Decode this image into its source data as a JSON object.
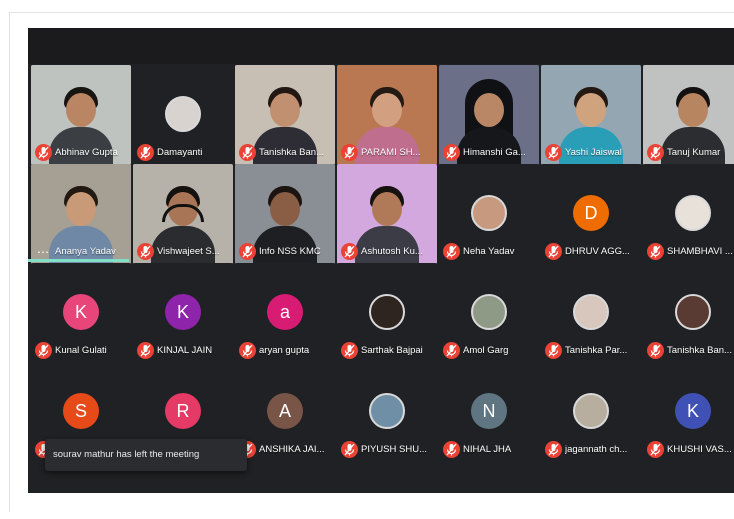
{
  "meeting": {
    "toast_message": "sourav mathur has left the meeting",
    "more_options_glyph": "⋯",
    "colors": {
      "muted_mic": "#ea4335",
      "tile_background": "#3c4043",
      "meeting_background": "#202124",
      "active_speaker": "#8ab4f8"
    }
  },
  "participants": [
    {
      "name": "Abhinav Gupta",
      "kind": "video",
      "bg": "#bfc3bf",
      "skin": "#b98562",
      "hair": "#171412",
      "shirt": "#3b3f44"
    },
    {
      "name": "Damayanti",
      "kind": "avatar",
      "photo": true,
      "avatar_color": "#d8d3ce"
    },
    {
      "name": "Tanishka Ban...",
      "kind": "video",
      "bg": "#c7bfb3",
      "skin": "#c19070",
      "hair": "#221712",
      "shirt": "#2e2d35"
    },
    {
      "name": "PARAMI SH...",
      "kind": "video",
      "bg": "#b97852",
      "skin": "#d2a080",
      "hair": "#231a14",
      "shirt": "#c06e8e"
    },
    {
      "name": "Himanshi Ga...",
      "kind": "video",
      "bg": "#6b6f87",
      "skin": "#b98765",
      "hair": "#101114",
      "shirt": "#16171b",
      "hood": true
    },
    {
      "name": "Yashi Jaiswal",
      "kind": "video",
      "bg": "#93a6b2",
      "skin": "#d0a37f",
      "hair": "#231912",
      "shirt": "#2a9db7"
    },
    {
      "name": "Tanuj Kumar",
      "kind": "video",
      "bg": "#c0c2c1",
      "skin": "#b88561",
      "hair": "#141210",
      "shirt": "#2c2d30"
    },
    {
      "name": "Ananya Yadav",
      "kind": "video",
      "bg": "#a69f94",
      "skin": "#c99a78",
      "hair": "#221913",
      "shirt": "#6e88a6",
      "active": true,
      "more": true
    },
    {
      "name": "Vishwajeet S...",
      "kind": "video",
      "bg": "#b6b1a9",
      "skin": "#a87556",
      "hair": "#15110f",
      "shirt": "#2b2c2f",
      "headset": true
    },
    {
      "name": "Info NSS KMC",
      "kind": "video",
      "bg": "#8a8f95",
      "skin": "#8a5e45",
      "hair": "#1b1411",
      "shirt": "#1e1f22"
    },
    {
      "name": "Ashutosh Ku...",
      "kind": "video",
      "bg": "#d3a8df",
      "skin": "#b07a58",
      "hair": "#151210",
      "shirt": "#3b3c45"
    },
    {
      "name": "Neha Yadav",
      "kind": "avatar",
      "photo": true,
      "avatar_color": "#c79a80"
    },
    {
      "name": "DHRUV AGG...",
      "kind": "avatar",
      "initial": "D",
      "avatar_color": "#ef6c00"
    },
    {
      "name": "SHAMBHAVI ...",
      "kind": "avatar",
      "photo": true,
      "avatar_color": "#e8e1da"
    },
    {
      "name": "Kunal Gulati",
      "kind": "avatar",
      "initial": "K",
      "avatar_color": "#e8457a"
    },
    {
      "name": "KINJAL JAIN",
      "kind": "avatar",
      "initial": "K",
      "avatar_color": "#8e24aa"
    },
    {
      "name": "aryan gupta",
      "kind": "avatar",
      "initial": "a",
      "avatar_color": "#d81b73"
    },
    {
      "name": "Sarthak Bajpai",
      "kind": "avatar",
      "photo": true,
      "avatar_color": "#2e2520"
    },
    {
      "name": "Amol Garg",
      "kind": "avatar",
      "photo": true,
      "avatar_color": "#8f9a86"
    },
    {
      "name": "Tanishka Par...",
      "kind": "avatar",
      "photo": true,
      "avatar_color": "#d7c7bd"
    },
    {
      "name": "Tanishka Ban...",
      "kind": "avatar",
      "photo": true,
      "avatar_color": "#5a3b33"
    },
    {
      "name": "",
      "kind": "avatar",
      "initial": "S",
      "avatar_color": "#e64a19"
    },
    {
      "name": "",
      "kind": "avatar",
      "initial": "R",
      "avatar_color": "#e53966"
    },
    {
      "name": "ANSHIKA JAI...",
      "kind": "avatar",
      "initial": "A",
      "avatar_color": "#795548"
    },
    {
      "name": "PIYUSH SHU...",
      "kind": "avatar",
      "photo": true,
      "avatar_color": "#6f8fa6"
    },
    {
      "name": "NIHAL JHA",
      "kind": "avatar",
      "initial": "N",
      "avatar_color": "#5f7582"
    },
    {
      "name": "jagannath ch...",
      "kind": "avatar",
      "photo": true,
      "avatar_color": "#b8ae9f"
    },
    {
      "name": "KHUSHI VAS...",
      "kind": "avatar",
      "initial": "K",
      "avatar_color": "#3f51b5"
    }
  ]
}
